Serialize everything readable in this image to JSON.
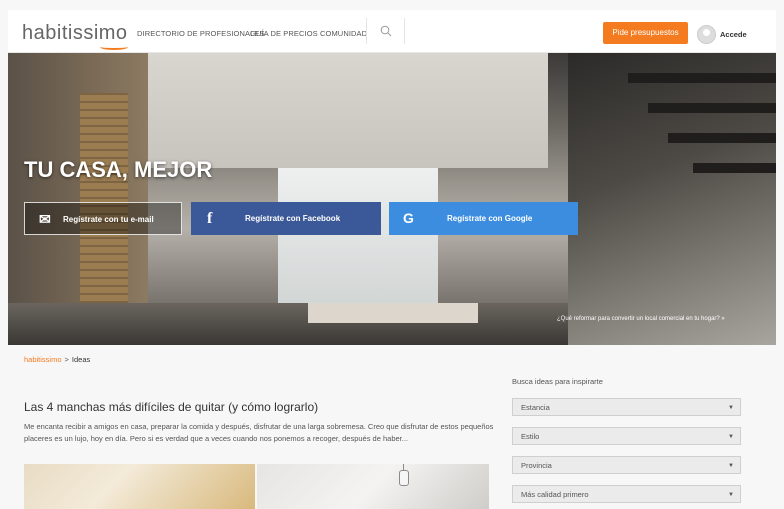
{
  "header": {
    "logo": "habitissimo",
    "nav": [
      "DIRECTORIO DE PROFESIONALES",
      "GUÍA DE PRECIOS",
      "COMUNIDAD"
    ],
    "cta": "Pide presupuestos",
    "login": "Accede",
    "accent": "#f47b20"
  },
  "hero": {
    "title": "TU CASA, MEJOR",
    "buttons": [
      {
        "label": "Regístrate con tu e-mail",
        "icon": "envelope-icon"
      },
      {
        "label": "Regístrate con Facebook",
        "icon": "facebook-icon",
        "color": "#3b5998"
      },
      {
        "label": "Regístrate con Google",
        "icon": "google-icon",
        "color": "#3c8de0"
      }
    ],
    "caption": "¿Qué reformar para convertir un local comercial en tu hogar? »"
  },
  "breadcrumb": {
    "home": "habitissimo",
    "separator": ">",
    "current": "Ideas"
  },
  "article": {
    "title": "Las 4 manchas más difíciles de quitar (y cómo lograrlo)",
    "excerpt": "Me encanta recibir a amigos en casa, preparar la comida y después, disfrutar de una larga sobremesa. Creo que disfrutar de estos pequeños placeres es un lujo, hoy en día. Pero si es verdad que a veces cuando nos ponemos a recoger, después de haber..."
  },
  "filters": {
    "label": "Busca ideas para inspirarte",
    "selects": [
      "Estancia",
      "Estilo",
      "Provincia",
      "Más calidad primero"
    ]
  }
}
